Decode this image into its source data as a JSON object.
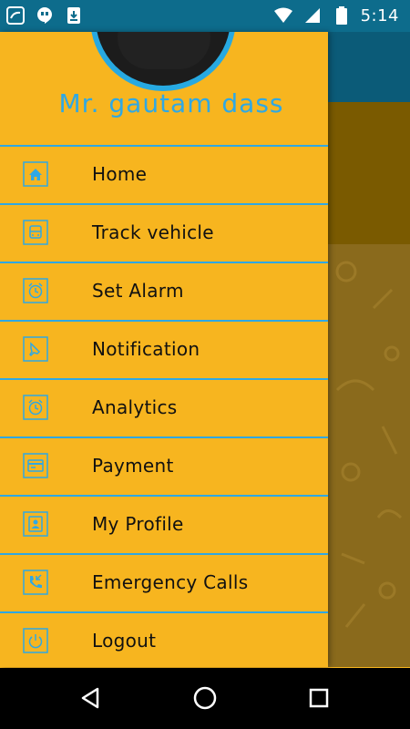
{
  "status_bar": {
    "time": "5:14",
    "left_icons": [
      "saavn-icon",
      "hangouts-icon",
      "download-icon"
    ],
    "right_icons": [
      "wifi-icon",
      "signal-icon",
      "battery-icon"
    ]
  },
  "drawer": {
    "user_name": "Mr. gautam dass",
    "items": [
      {
        "label": "Home",
        "icon": "home-icon"
      },
      {
        "label": "Track vehicle",
        "icon": "bus-icon"
      },
      {
        "label": "Set Alarm",
        "icon": "alarm-icon"
      },
      {
        "label": "Notification",
        "icon": "bell-icon"
      },
      {
        "label": "Analytics",
        "icon": "alarm-icon"
      },
      {
        "label": "Payment",
        "icon": "payment-card-icon"
      },
      {
        "label": "My Profile",
        "icon": "profile-badge-icon"
      },
      {
        "label": "Emergency Calls",
        "icon": "phone-call-icon"
      },
      {
        "label": "Logout",
        "icon": "power-icon"
      }
    ]
  },
  "nav_bar": {
    "buttons": [
      "back-icon",
      "home-circle-icon",
      "recents-icon"
    ]
  },
  "colors": {
    "drawer_bg": "#f7b51f",
    "accent": "#2fa8e4",
    "status_bar": "#0d6c8c"
  }
}
